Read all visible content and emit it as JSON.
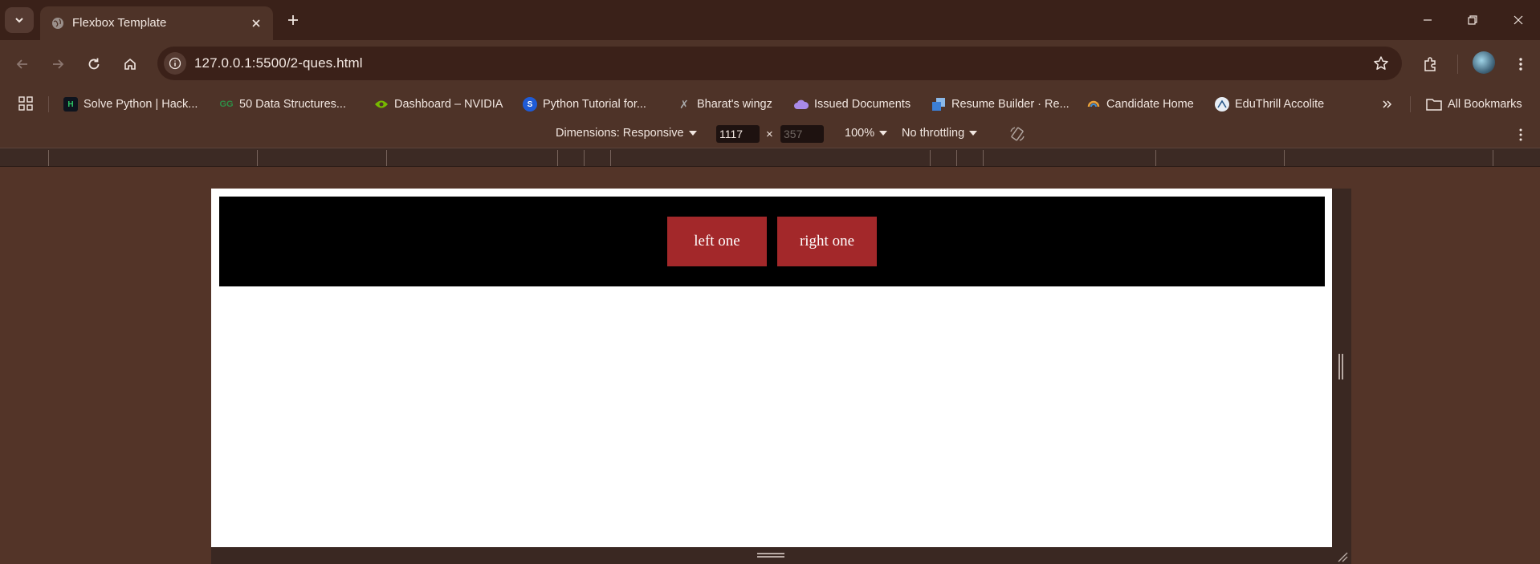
{
  "browser": {
    "tab": {
      "title": "Flexbox Template",
      "favicon": "globe-icon"
    },
    "url": "127.0.0.1:5500/2-ques.html"
  },
  "bookmarks": {
    "items": [
      {
        "label": "Solve Python | Hack...",
        "icon": "hackerrank-icon"
      },
      {
        "label": "50 Data Structures...",
        "icon": "gfg-icon"
      },
      {
        "label": "Dashboard – NVIDIA",
        "icon": "nvidia-icon"
      },
      {
        "label": "Python Tutorial for...",
        "icon": "python-tutorial-icon"
      },
      {
        "label": "Bharat's wingz",
        "icon": "wingz-icon"
      },
      {
        "label": "Issued Documents",
        "icon": "cloud-docs-icon"
      },
      {
        "label": "Resume Builder · Re...",
        "icon": "resume-icon"
      },
      {
        "label": "Candidate Home",
        "icon": "candidate-icon"
      },
      {
        "label": "EduThrill Accolite",
        "icon": "eduthrill-icon"
      }
    ],
    "all_bookmarks": "All Bookmarks"
  },
  "devtools": {
    "dimensions_label": "Dimensions: Responsive",
    "width": "1117",
    "times": "×",
    "height_placeholder": "357",
    "zoom": "100%",
    "throttling": "No throttling"
  },
  "page": {
    "buttons": [
      "left one",
      "right one"
    ],
    "item_color": "#a3282a",
    "container_color": "#000000"
  }
}
